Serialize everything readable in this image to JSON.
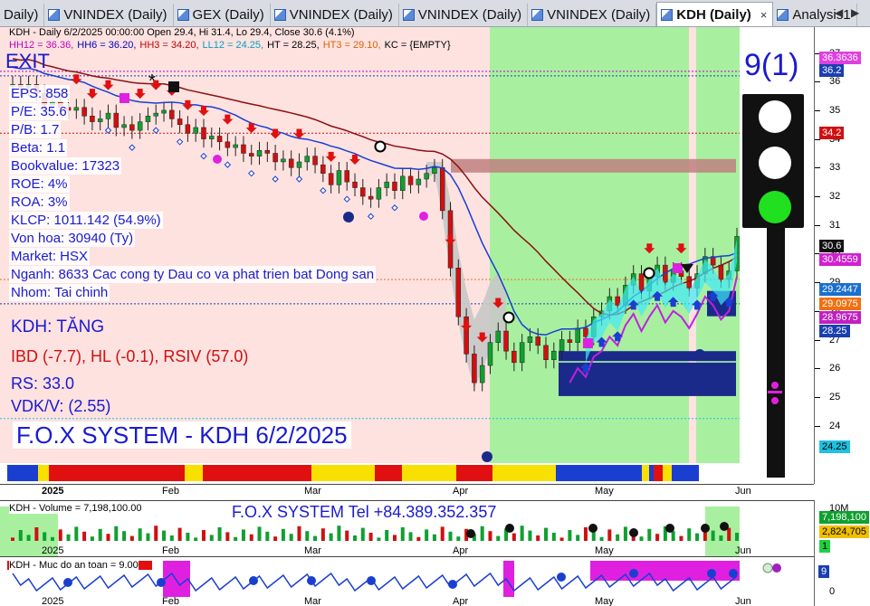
{
  "tabs": [
    {
      "label": "Daily)",
      "active": false
    },
    {
      "label": "VNINDEX (Daily)",
      "active": false
    },
    {
      "label": "GEX (Daily)",
      "active": false
    },
    {
      "label": "VNINDEX (Daily)",
      "active": false
    },
    {
      "label": "VNINDEX (Daily)",
      "active": false
    },
    {
      "label": "VNINDEX (Daily)",
      "active": false
    },
    {
      "label": "KDH (Daily)",
      "active": true
    },
    {
      "label": "Analysis1",
      "active": false
    }
  ],
  "tab_close": "×",
  "tab_nav_prev": "◀",
  "tab_nav_next": "▶",
  "price_pane": {
    "header_line1": "KDH - Daily 6/2/2025 00:00:00 Open 29.4, Hi 31.4, Lo 29.4, Close 30.6 (4.1%)",
    "header_line2": [
      {
        "text": "HH12 = 36.36,",
        "color": "#c000c0"
      },
      {
        "text": "HH6 = 36.20,",
        "color": "#0000c0"
      },
      {
        "text": "HH3 = 34.20,",
        "color": "#c00000"
      },
      {
        "text": "LL12 = 24.25,",
        "color": "#00a0c0"
      },
      {
        "text": "HT = 28.25,",
        "color": "#000000"
      },
      {
        "text": "HT3 = 29.10,",
        "color": "#e06000"
      },
      {
        "text": "KC = {EMPTY}",
        "color": "#000000"
      }
    ],
    "exit_label": "EXIT",
    "fundamentals": [
      "EPS: 858",
      "P/E: 35.6",
      "P/B: 1.7",
      "Beta: 1.1",
      "Bookvalue: 17323",
      "ROE: 4%",
      "ROA: 3%",
      "KLCP: 1011.142 (54.9%)",
      "Von hoa: 30940 (Ty)",
      "Market: HSX",
      "Nganh: 8633 Cac cong ty Dau co va phat trien bat Dong san",
      "Nhom: Tai chinh"
    ],
    "status": "KDH: TĂNG",
    "ibd_line": "IBD (-7.7), HL (-0.1), RSIV (57.0)",
    "rs_line": "RS: 33.0",
    "vdk_line": "VDK/V:  (2.55)",
    "system_title": "F.O.X SYSTEM - KDH 6/2/2025",
    "signal_count": "9(1)",
    "y_ticks": [
      "37",
      "36",
      "35",
      "34",
      "33",
      "32",
      "31",
      "30",
      "29",
      "28",
      "27",
      "26",
      "25",
      "24"
    ],
    "price_labels": [
      {
        "text": "36.3636",
        "bg": "#e040e0",
        "fg": "#ffffff"
      },
      {
        "text": "36.2",
        "bg": "#1a3fb0",
        "fg": "#ffffff"
      },
      {
        "text": "34.2",
        "bg": "#d01010",
        "fg": "#ffffff"
      },
      {
        "text": "30.6",
        "bg": "#111111",
        "fg": "#ffffff"
      },
      {
        "text": "30.4559",
        "bg": "#d020d0",
        "fg": "#ffffff"
      },
      {
        "text": "29.2447",
        "bg": "#1a6fd0",
        "fg": "#ffffff"
      },
      {
        "text": "29.0975",
        "bg": "#f07010",
        "fg": "#ffffff"
      },
      {
        "text": "28.9675",
        "bg": "#c020c0",
        "fg": "#ffffff"
      },
      {
        "text": "28.25",
        "bg": "#1a3fb0",
        "fg": "#ffffff"
      },
      {
        "text": "24.25",
        "bg": "#20c0e0",
        "fg": "#000000"
      }
    ],
    "months": [
      "2025",
      "Feb",
      "Mar",
      "Apr",
      "May",
      "Jun"
    ]
  },
  "volume_pane": {
    "header": "KDH - Volume = 7,198,100.00",
    "title": "F.O.X SYSTEM Tel +84.389.352.357",
    "y_top": "10M",
    "labels": [
      {
        "text": "7,198,100",
        "bg": "#10a030",
        "fg": "#ffffff"
      },
      {
        "text": "2,824,705",
        "bg": "#f0c000",
        "fg": "#000000"
      },
      {
        "text": "1",
        "bg": "#20d040",
        "fg": "#000000"
      }
    ],
    "months": [
      "2025",
      "Feb",
      "Mar",
      "Apr",
      "May",
      "Jun"
    ]
  },
  "safety_pane": {
    "header": "KDH - Muc do an toan = 9.00",
    "label": "9",
    "y_bottom": "0",
    "months": [
      "2025",
      "Feb",
      "Mar",
      "Apr",
      "May",
      "Jun"
    ]
  }
}
